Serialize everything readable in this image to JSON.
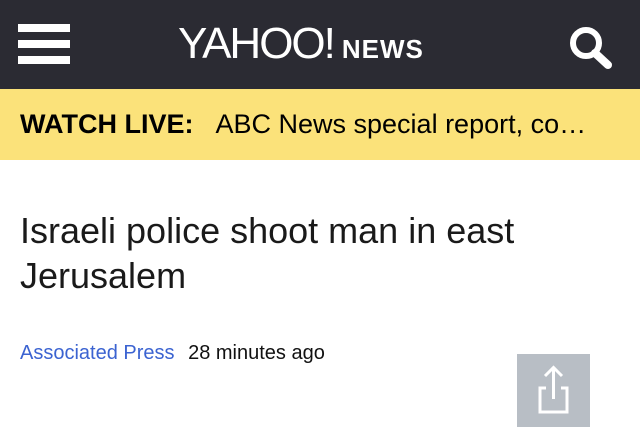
{
  "header": {
    "menu_icon": "hamburger-menu-icon",
    "brand": "YAHOO!",
    "section": "NEWS",
    "search_icon": "search-icon",
    "background_color": "#2b2b33"
  },
  "live_banner": {
    "label": "WATCH LIVE:",
    "text": "ABC News special report, co…",
    "background_color": "#fbe27a"
  },
  "article": {
    "headline": "Israeli police shoot man in east Jerusalem",
    "source": "Associated Press",
    "time": "28 minutes ago",
    "source_color": "#3b63d1",
    "share_icon": "share-icon"
  }
}
